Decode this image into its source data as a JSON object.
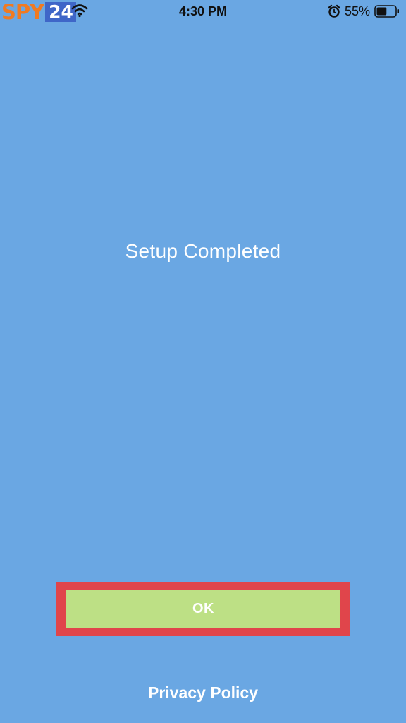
{
  "status_bar": {
    "logo_spy": "SPY",
    "logo_num": "24",
    "time": "4:30 PM",
    "battery_percent": "55%",
    "battery_level": 0.55,
    "icons": [
      "wifi-icon",
      "alarm-icon",
      "battery-icon"
    ]
  },
  "main": {
    "message": "Setup Completed"
  },
  "actions": {
    "ok_label": "OK",
    "privacy_label": "Privacy Policy"
  },
  "colors": {
    "background": "#6aa7e3",
    "ok_button": "#bde085",
    "highlight_border": "#e0454b",
    "logo_orange": "#f07a22",
    "logo_blue": "#3f66c8"
  }
}
